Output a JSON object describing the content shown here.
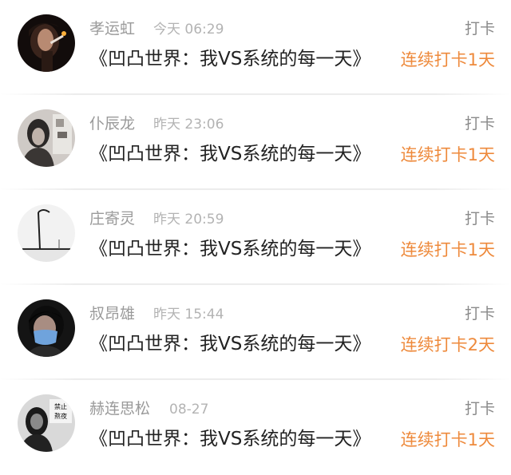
{
  "feed": {
    "action_label": "打卡",
    "entries": [
      {
        "name": "孝运虹",
        "time": "今天 06:29",
        "book": "《凹凸世界：我VS系统的每一天》",
        "streak": "连续打卡1天"
      },
      {
        "name": "仆辰龙",
        "time": "昨天 23:06",
        "book": "《凹凸世界：我VS系统的每一天》",
        "streak": "连续打卡1天"
      },
      {
        "name": "庄寄灵",
        "time": "昨天 20:59",
        "book": "《凹凸世界：我VS系统的每一天》",
        "streak": "连续打卡1天"
      },
      {
        "name": "叔昂雄",
        "time": "昨天 15:44",
        "book": "《凹凸世界：我VS系统的每一天》",
        "streak": "连续打卡2天"
      },
      {
        "name": "赫连思松",
        "time": "08-27",
        "book": "《凹凸世界：我VS系统的每一天》",
        "streak": "连续打卡1天"
      }
    ]
  },
  "avatar_sign_text": [
    "禁止",
    "熬夜"
  ],
  "colors": {
    "name": "#9a9a9a",
    "time": "#b3b3b3",
    "action": "#8a8a8a",
    "book_title": "#222222",
    "streak": "#ee8a3c"
  }
}
